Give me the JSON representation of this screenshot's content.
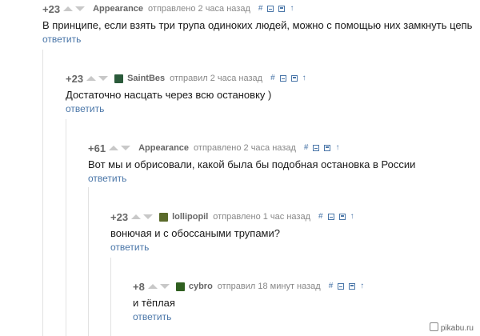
{
  "comments": [
    {
      "rating": "+23",
      "author": "Appearance",
      "meta": "отправлено 2 часа назад",
      "text": "В принципе, если взять три трупа одиноких людей, можно с помощью них замкнуть цепь",
      "reply": "ответить",
      "hash": "#",
      "arrow": "↑",
      "avatar": null
    },
    {
      "rating": "+23",
      "author": "SaintBes",
      "meta": "отправил 2 часа назад",
      "text": "Достаточно насцать через всю остановку )",
      "reply": "ответить",
      "hash": "#",
      "arrow": "↑",
      "avatar": "#2a5a3a"
    },
    {
      "rating": "+61",
      "author": "Appearance",
      "meta": "отправлено 2 часа назад",
      "text": "Вот мы и обрисовали, какой была бы подобная остановка в России",
      "reply": "ответить",
      "hash": "#",
      "arrow": "↑",
      "avatar": null
    },
    {
      "rating": "+23",
      "author": "lollipopil",
      "meta": "отправлено 1 час назад",
      "text": "вонючая и с обоссаными трупами?",
      "reply": "ответить",
      "hash": "#",
      "arrow": "↑",
      "avatar": "#5a6a2a"
    },
    {
      "rating": "+8",
      "author": "cybro",
      "meta": "отправил 18 минут назад",
      "text": "и тёплая",
      "reply": "ответить",
      "hash": "#",
      "arrow": "↑",
      "avatar": "#2f5f1f"
    }
  ],
  "watermark": "pikabu.ru",
  "colors": {
    "link": "#4a76a8",
    "muted": "#888888",
    "arrow": "#c8c8c8"
  }
}
